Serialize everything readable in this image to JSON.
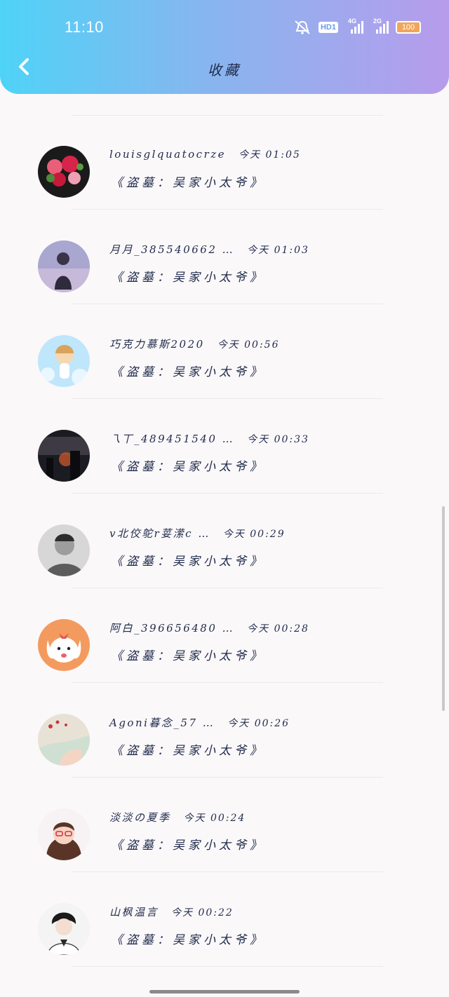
{
  "status_bar": {
    "time": "11:10",
    "battery": "100",
    "network_1": "4G",
    "network_2": "2G",
    "hd": "HD1"
  },
  "header": {
    "title": "收藏"
  },
  "favorites": [
    {
      "name": "louisglquatocrze",
      "time": "今天 01:05",
      "text": "《盗墓：吴家小太爷》"
    },
    {
      "name": "月月_385540662 …",
      "time": "今天 01:03",
      "text": "《盗墓：吴家小太爷》"
    },
    {
      "name": "巧克力慕斯2020",
      "time": "今天 00:56",
      "text": "《盗墓：吴家小太爷》"
    },
    {
      "name": "乁丅_489451540 …",
      "time": "今天 00:33",
      "text": "《盗墓：吴家小太爷》"
    },
    {
      "name": "v北佼鸵r荽潆c …",
      "time": "今天 00:29",
      "text": "《盗墓：吴家小太爷》"
    },
    {
      "name": "阿白_396656480 …",
      "time": "今天 00:28",
      "text": "《盗墓：吴家小太爷》"
    },
    {
      "name": "Agoni暮念_57 …",
      "time": "今天 00:26",
      "text": "《盗墓：吴家小太爷》"
    },
    {
      "name": "淡淡の夏季",
      "time": "今天 00:24",
      "text": "《盗墓：吴家小太爷》"
    },
    {
      "name": "山枫温言",
      "time": "今天 00:22",
      "text": "《盗墓：吴家小太爷》"
    }
  ],
  "colors": {
    "header_start": "#4fd3f7",
    "header_end": "#b79cec",
    "text": "#1e2a4a"
  }
}
